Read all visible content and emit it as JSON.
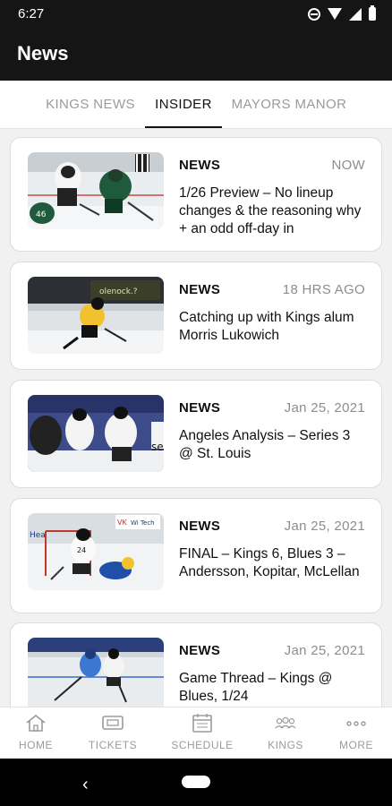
{
  "status": {
    "time": "6:27"
  },
  "header": {
    "title": "News"
  },
  "tabs": [
    {
      "label": "KINGS NEWS",
      "active": false
    },
    {
      "label": "INSIDER",
      "active": true
    },
    {
      "label": "MAYORS MANOR",
      "active": false
    }
  ],
  "articles": [
    {
      "category": "NEWS",
      "time": "NOW",
      "title": "1/26 Preview – No lineup changes & the reasoning why + an odd off-day in"
    },
    {
      "category": "NEWS",
      "time": "18 HRS AGO",
      "title": "Catching up with Kings alum Morris Lukowich"
    },
    {
      "category": "NEWS",
      "time": "Jan 25, 2021",
      "title": "Angeles Analysis – Series 3 @ St. Louis"
    },
    {
      "category": "NEWS",
      "time": "Jan 25, 2021",
      "title": "FINAL – Kings 6, Blues 3 – Andersson, Kopitar, McLellan"
    },
    {
      "category": "NEWS",
      "time": "Jan 25, 2021",
      "title": "Game Thread – Kings @ Blues, 1/24"
    }
  ],
  "bottom_nav": [
    {
      "label": "HOME",
      "icon": "home-icon"
    },
    {
      "label": "TICKETS",
      "icon": "ticket-icon"
    },
    {
      "label": "SCHEDULE",
      "icon": "calendar-icon"
    },
    {
      "label": "KINGS",
      "icon": "team-icon"
    },
    {
      "label": "MORE",
      "icon": "more-icon"
    }
  ],
  "colors": {
    "app_bar": "#151515",
    "accent": "#111111",
    "muted": "#9a9a9a"
  }
}
